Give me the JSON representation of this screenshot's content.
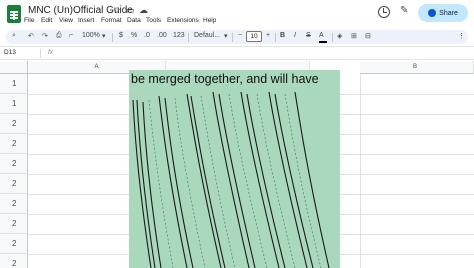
{
  "doc": {
    "title": "MNC (Un)Official Guide"
  },
  "menu": [
    "File",
    "Edit",
    "View",
    "Insert",
    "Format",
    "Data",
    "Tools",
    "Extensions",
    "Help"
  ],
  "share": {
    "label": "Share"
  },
  "toolbar": {
    "zoom": "100%",
    "currency": "$",
    "percent": "%",
    "decrease_decimal": ".0",
    "increase_decimal": ".00",
    "number_format": "123",
    "font": "Defaul...",
    "minus": "−",
    "font_size": "10",
    "plus": "+",
    "bold": "B",
    "italic": "I",
    "strikethrough": "S",
    "text_color": "A",
    "fill_icon": "paint-bucket-icon",
    "borders_icon": "borders-icon",
    "merge_icon": "merge-cells-icon",
    "more": "⋮"
  },
  "formula_bar": {
    "cell_ref": "D13",
    "fx": "fx"
  },
  "grid": {
    "columns": [
      "A",
      "B"
    ],
    "row_labels": [
      "1",
      "1",
      "2",
      "2",
      "2",
      "2",
      "2",
      "2",
      "2",
      "2"
    ],
    "merged_cell_text": "be merged together, and will have",
    "merged_cell_color": "#a9d8bd"
  },
  "colors": {
    "accent": "#188038",
    "share_bg": "#c2e7ff",
    "toolbar_bg": "#edf2fa"
  }
}
